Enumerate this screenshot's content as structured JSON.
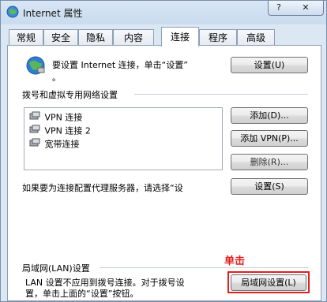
{
  "window": {
    "title": "Internet 属性",
    "help_label": "?",
    "close_label": "✕"
  },
  "tabs": [
    {
      "label": "常规"
    },
    {
      "label": "安全"
    },
    {
      "label": "隐私"
    },
    {
      "label": "内容"
    },
    {
      "label": "连接"
    },
    {
      "label": "程序"
    },
    {
      "label": "高级"
    }
  ],
  "active_tab": "连接",
  "setup": {
    "text_line1": "要设置 Internet 连接，单击“设置”",
    "text_line2": "。",
    "button_label": "设置(U)"
  },
  "dialup": {
    "heading": "拨号和虚拟专用网络设置",
    "connections": [
      "VPN 连接",
      "VPN 连接 2",
      "宽带连接"
    ],
    "add_label": "添加(D)...",
    "add_vpn_label": "添加 VPN(P)...",
    "remove_label": "删除(R)...",
    "proxy_text": "如果要为连接配置代理服务器，请选择“设",
    "settings_label": "设置(S)"
  },
  "lan": {
    "heading": "局域网(LAN)设置",
    "text_line1": "LAN 设置不应用到拨号连接。对于拨号设",
    "text_line2": "置，单击上面的“设置”按钮。",
    "button_label": "局域网设置(L)"
  },
  "annotation": {
    "label": "单击",
    "color": "#e02020"
  },
  "colors": {
    "panel_bg": "#ffffff",
    "window_bg": "#dce7f4",
    "accent": "#e02020"
  }
}
